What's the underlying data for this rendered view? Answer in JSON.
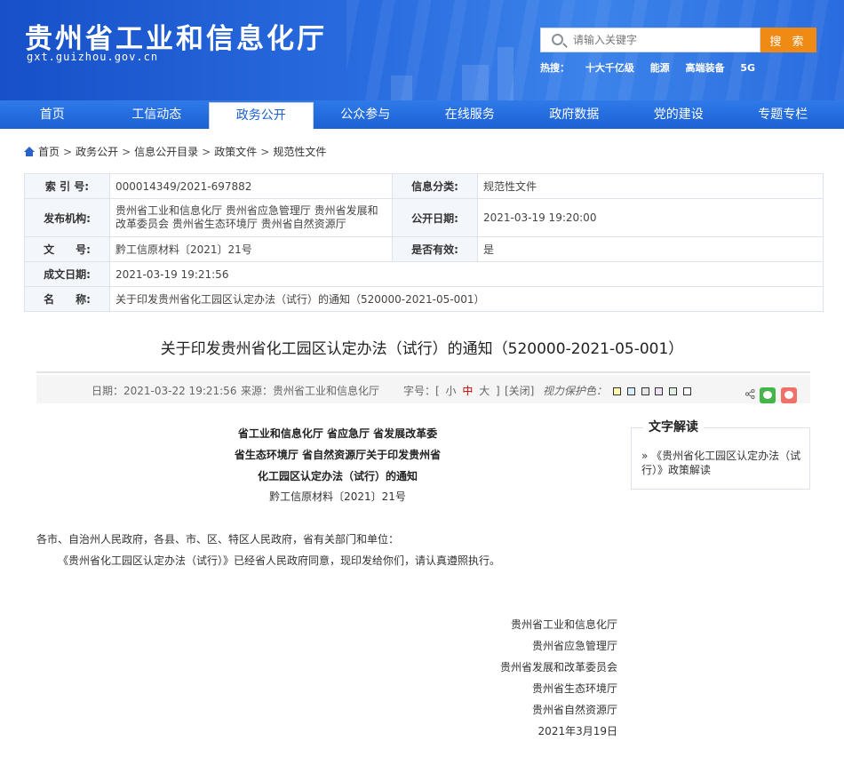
{
  "header": {
    "title": "贵州省工业和信息化厅",
    "url": "gxt.guizhou.gov.cn",
    "search_placeholder": "请输入关键字",
    "search_button": "搜 索",
    "hotwords": [
      "热搜：",
      "十大千亿级",
      "能源",
      "高端装备",
      "5G"
    ]
  },
  "nav": {
    "items": [
      "首页",
      "工信动态",
      "政务公开",
      "公众参与",
      "在线服务",
      "政府数据",
      "党的建设",
      "专题专栏"
    ],
    "active_index": 2
  },
  "breadcrumb": [
    "首页",
    "政务公开",
    "信息公开目录",
    "政策文件",
    "规范性文件"
  ],
  "info": {
    "index_label": "索 引 号:",
    "index_value": "000014349/2021-697882",
    "category_label": "信息分类:",
    "category_value": "规范性文件",
    "issuer_label": "发布机构:",
    "issuer_value_line1": "贵州省工业和信息化厅 贵州省应急管理厅 贵州省发展和",
    "issuer_value_line2": "改革委员会 贵州省生态环境厅 贵州省自然资源厅",
    "pubdate_label": "公开日期:",
    "pubdate_value": "2021-03-19 19:20:00",
    "docno_label": "文　　号:",
    "docno_value": "黔工信原材料〔2021〕21号",
    "valid_label": "是否有效:",
    "valid_value": "是",
    "created_label": "成文日期:",
    "created_value": "2021-03-19 19:21:56",
    "name_label": "名　　称:",
    "name_value": "关于印发贵州省化工园区认定办法（试行）的通知（520000-2021-05-001）"
  },
  "article": {
    "title": "关于印发贵州省化工园区认定办法（试行）的通知（520000-2021-05-001）",
    "date": "日期：2021-03-22 19:21:56",
    "source": "来源：贵州省工业和信息化厅",
    "fontsize_prefix": "字号：[",
    "fontsize_small": "小",
    "fontsize_mid": "中",
    "fontsize_large": "大",
    "fontsize_suffix": "]",
    "close": "[关闭]",
    "eye_color_label": "视力保护色：",
    "eye_colors": [
      "#fdf7b0",
      "#d8ecfd",
      "#e6e6e6",
      "#f1e0f8",
      "#e0f0e0",
      "#ffffff"
    ],
    "head_line1": "省工业和信息化厅  省应急厅  省发展改革委",
    "head_line2": "省生态环境厅  省自然资源厅关于印发贵州省",
    "head_line3": "化工园区认定办法（试行）的通知",
    "doc_number": "黔工信原材料〔2021〕21号",
    "addressee": "各市、自治州人民政府，各县、市、区、特区人民政府，省有关部门和单位：",
    "body": "《贵州省化工园区认定办法（试行）》已经省人民政府同意，现印发给你们，请认真遵照执行。",
    "signatures": [
      "贵州省工业和信息化厅",
      "贵州省应急管理厅",
      "贵州省发展和改革委员会",
      "贵州省生态环境厅",
      "贵州省自然资源厅",
      "2021年3月19日"
    ]
  },
  "sidebar": {
    "title": "文字解读",
    "link": "» 《贵州省化工园区认定办法（试行）》政策解读"
  }
}
